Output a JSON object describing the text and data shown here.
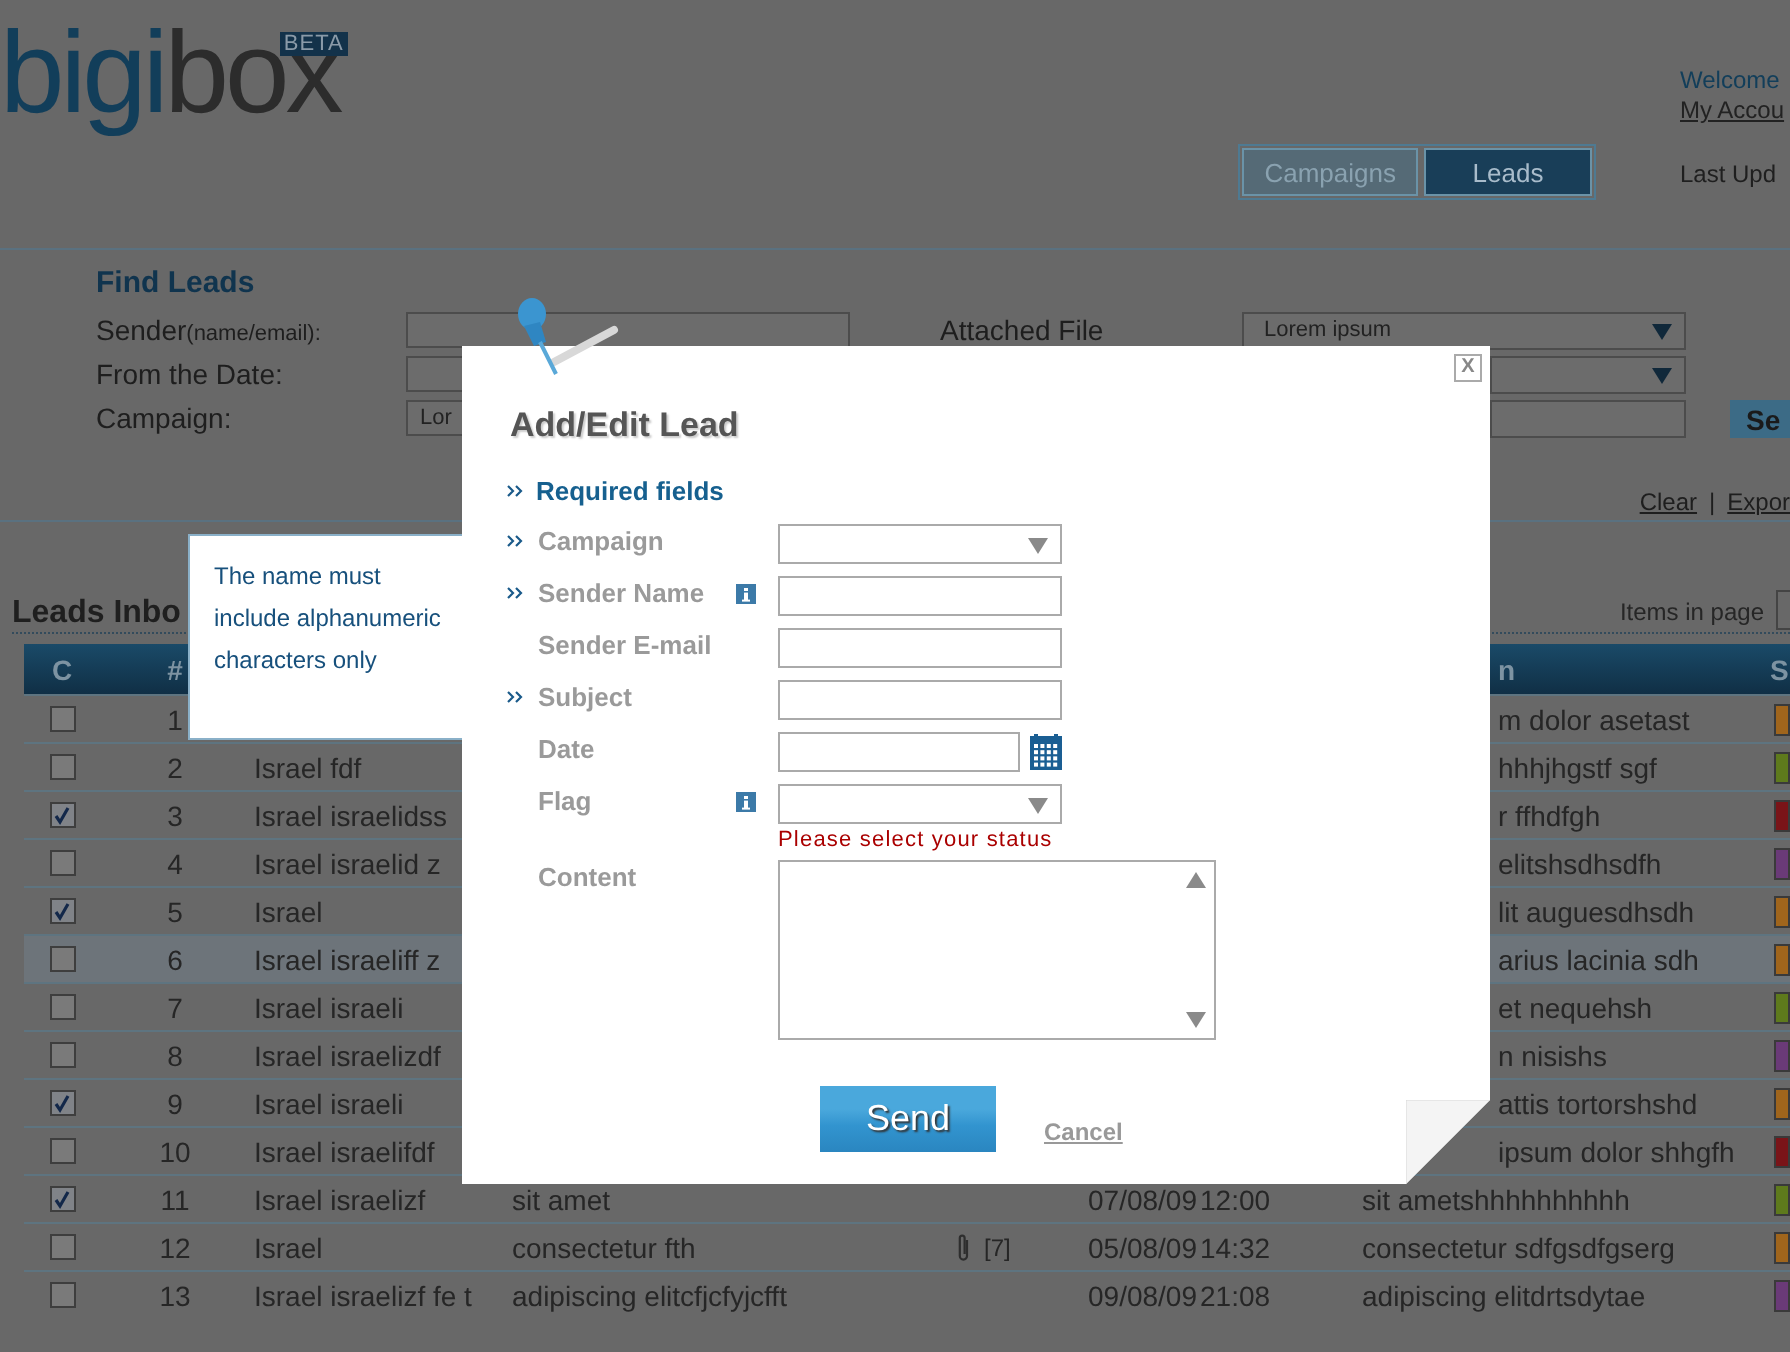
{
  "header": {
    "logo_parts": [
      "bigi",
      "box"
    ],
    "badge": "BETA",
    "welcome": "Welcome",
    "account_link": "My Accou",
    "last_update": "Last Upd"
  },
  "nav_tabs": [
    {
      "label": "Campaigns",
      "selected": false
    },
    {
      "label": "Leads",
      "selected": true
    }
  ],
  "find_leads": {
    "title": "Find Leads",
    "rows": [
      {
        "label": "Sender",
        "label_note": "(name/email):",
        "value": "",
        "right_label": "Attached File",
        "right_control": {
          "kind": "select",
          "value": "Lorem ipsum"
        }
      },
      {
        "label": "From the Date:",
        "value": "",
        "right_control": {
          "kind": "select"
        }
      },
      {
        "label": "Campaign:",
        "value": "Lor",
        "right_control": {
          "kind": "input"
        }
      }
    ],
    "search_button": "Se",
    "links": [
      "Clear",
      "Expor"
    ],
    "separator": "|"
  },
  "inbox": {
    "title": "Leads Inbo",
    "items_label": "Items in page",
    "columns": {
      "check": "C",
      "number": "#",
      "description": "n",
      "status": "S"
    },
    "rows": [
      {
        "checked": false,
        "selected": false,
        "number": "1",
        "description": "m dolor asetast",
        "color": "#a0651c"
      },
      {
        "checked": false,
        "selected": false,
        "number": "2",
        "sender": "Israel  fdf",
        "description": "hhhjhgstf sgf",
        "color": "#5e7a1c"
      },
      {
        "checked": true,
        "selected": false,
        "number": "3",
        "sender": "Israel israelidss",
        "description": "r ffhdfgh",
        "color": "#7a1418"
      },
      {
        "checked": false,
        "selected": false,
        "number": "4",
        "sender": "Israel israelid z",
        "description": "elitshsdhsdfh",
        "color": "#6a3a78"
      },
      {
        "checked": true,
        "selected": false,
        "number": "5",
        "sender": "Israel",
        "description": "lit auguesdhsdh",
        "color": "#a0651c"
      },
      {
        "checked": false,
        "selected": true,
        "number": "6",
        "sender": "Israel israeliff z",
        "description": "arius lacinia sdh",
        "color": "#a0651c"
      },
      {
        "checked": false,
        "selected": false,
        "number": "7",
        "sender": "Israel israeli",
        "description": "et nequehsh",
        "color": "#5e7a1c"
      },
      {
        "checked": false,
        "selected": false,
        "number": "8",
        "sender": "Israel israelizdf",
        "description": "n nisishs",
        "color": "#6a3a78"
      },
      {
        "checked": true,
        "selected": false,
        "number": "9",
        "sender": "Israel israeli",
        "description": "attis tortorshshd",
        "color": "#a0651c"
      },
      {
        "checked": false,
        "selected": false,
        "number": "10",
        "sender": "Israel israelifdf",
        "description": "ipsum dolor shhgfh",
        "color": "#7a1418"
      },
      {
        "checked": true,
        "selected": false,
        "number": "11",
        "sender": "Israel israelizf",
        "subject": "sit amet",
        "date": "07/08/09",
        "time": "12:00",
        "description": "sit ametshhhhhhhhhh",
        "color": "#5e7a1c"
      },
      {
        "checked": false,
        "selected": false,
        "number": "12",
        "sender": "Israel",
        "subject": "consectetur fth",
        "attachments": "[7]",
        "date": "05/08/09",
        "time": "14:32",
        "description": "consectetur sdfgsdfgserg",
        "color": "#a0651c"
      },
      {
        "checked": false,
        "selected": false,
        "number": "13",
        "sender": "Israel israelizf fe t",
        "subject": "adipiscing elitcfjcfyjcfft",
        "date": "09/08/09",
        "time": "21:08",
        "description": "adipiscing elitdrtsdytae",
        "color": "#6a3a78"
      }
    ]
  },
  "tooltip": {
    "text": "The name must include alphanumeric characters only"
  },
  "modal": {
    "title": "Add/Edit Lead",
    "close_label": "X",
    "required_note": "Required fields",
    "fields": [
      {
        "kind": "select",
        "label": "Campaign",
        "required": true,
        "info": false
      },
      {
        "kind": "text",
        "label": "Sender Name",
        "required": true,
        "info": true
      },
      {
        "kind": "text",
        "label": "Sender E-mail",
        "required": false,
        "info": false
      },
      {
        "kind": "text",
        "label": "Subject",
        "required": true,
        "info": false
      },
      {
        "kind": "date",
        "label": "Date",
        "required": false,
        "info": false
      },
      {
        "kind": "select",
        "label": "Flag",
        "required": false,
        "info": true,
        "error": "Please select your status"
      },
      {
        "kind": "textarea",
        "label": "Content",
        "required": false,
        "info": false
      }
    ],
    "send_button": "Send",
    "cancel_link": "Cancel"
  }
}
